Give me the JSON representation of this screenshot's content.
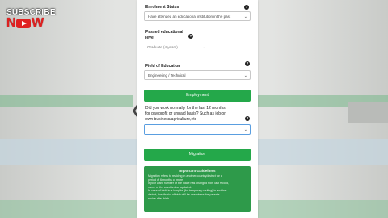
{
  "logo": {
    "top": "SUBSCRIBE",
    "left": "N",
    "right": "W"
  },
  "form": {
    "enrolment_status": {
      "label": "Enrolment Status",
      "value": "Have attended an educational institution in the past"
    },
    "passed": {
      "label_line1": "Passed educational",
      "label_line2": "level",
      "value": "Graduate (4 years)"
    },
    "field": {
      "label": "Field of Education",
      "value": "Engineering / Technical"
    },
    "employment_button": "Employment",
    "work_question": {
      "line1": "Did you work normally for the last 12 months",
      "line2": "for pay,profit or unpaid basis? Such as job or",
      "line3": "own business/agriculture,etc"
    },
    "migration_button": "Migration",
    "guidelines": {
      "title": "Important Guidelines",
      "lines": [
        "Migration refers to residing in another country/district for a",
        "period of 6 months or more.",
        "If your ward number of the place has changed from last record,",
        "name of the ward is also updated.",
        "In case of birth in a hospital (for temporary visiting) in another",
        "district, the district of birth will be one where the parents",
        "reside after birth."
      ]
    }
  }
}
